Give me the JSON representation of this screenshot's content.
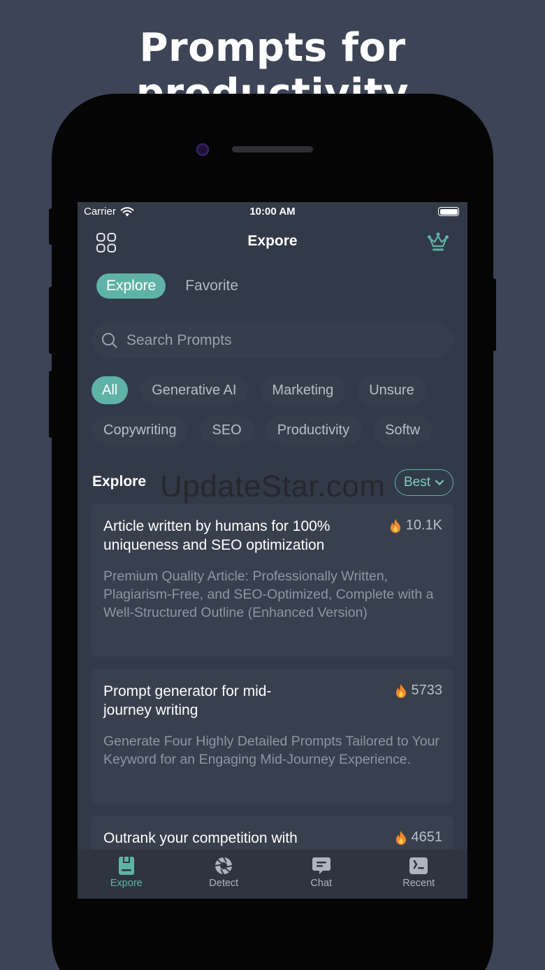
{
  "headline": "Prompts for productivity",
  "status_bar": {
    "carrier": "Carrier",
    "time": "10:00 AM"
  },
  "nav": {
    "title": "Expore"
  },
  "segments": [
    {
      "label": "Explore",
      "active": true
    },
    {
      "label": "Favorite",
      "active": false
    }
  ],
  "search": {
    "placeholder": "Search Prompts",
    "value": ""
  },
  "categories_row1": [
    {
      "label": "All",
      "active": true
    },
    {
      "label": "Generative AI",
      "active": false
    },
    {
      "label": "Marketing",
      "active": false
    },
    {
      "label": "Unsure",
      "active": false
    }
  ],
  "categories_row2": [
    {
      "label": "Copywriting"
    },
    {
      "label": "SEO"
    },
    {
      "label": "Productivity"
    },
    {
      "label": "Softw"
    }
  ],
  "section": {
    "title": "Explore",
    "sort_label": "Best"
  },
  "watermark": "UpdateStar.com",
  "cards": [
    {
      "title": "Article written by humans for 100% uniqueness and SEO optimization",
      "count": "10.1K",
      "description": "Premium Quality Article: Professionally Written, Plagiarism-Free, and SEO-Optimized, Complete with a Well-Structured Outline (Enhanced Version)"
    },
    {
      "title": "Prompt generator for mid-journey writing",
      "count": "5733",
      "description": "Generate Four Highly Detailed Prompts Tailored to Your Keyword for an Engaging Mid-Journey Experience."
    },
    {
      "title": "Outrank your competition with",
      "count": "4651",
      "description": ""
    }
  ],
  "tabs": [
    {
      "label": "Expore",
      "icon": "prompt-book-icon",
      "active": true
    },
    {
      "label": "Detect",
      "icon": "aperture-icon",
      "active": false
    },
    {
      "label": "Chat",
      "icon": "chat-bubble-icon",
      "active": false
    },
    {
      "label": "Recent",
      "icon": "history-icon",
      "active": false
    }
  ],
  "colors": {
    "accent": "#5fb3a6",
    "background": "#3c4456",
    "screen": "#323a47",
    "card": "#383f4d"
  }
}
